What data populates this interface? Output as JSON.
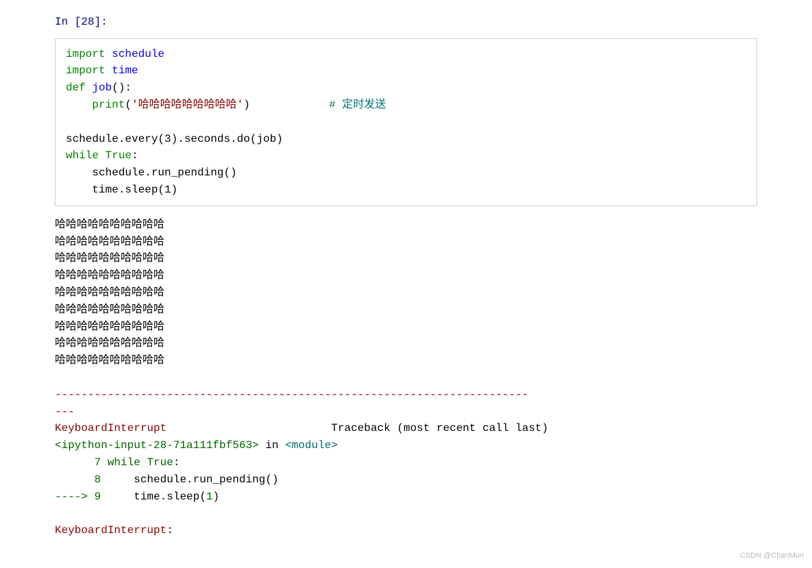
{
  "prompt": "In  [28]:",
  "code": {
    "l1": {
      "kw": "import",
      "mod": " schedule"
    },
    "l2": {
      "kw": "import",
      "mod": " time"
    },
    "l3": {
      "kw": "def",
      "name": " job",
      "paren": "():"
    },
    "l4": {
      "indent": "    ",
      "fn": "print",
      "open": "(",
      "str": "'哈哈哈哈哈哈哈哈哈'",
      "close": ")",
      "pad": "            ",
      "comment": "# 定时发送"
    },
    "l5": "",
    "l6": "schedule.every(3).seconds.do(job)",
    "l7": {
      "kw": "while",
      "cond": " True",
      "colon": ":"
    },
    "l8": "    schedule.run_pending()",
    "l9": "    time.sleep(1)"
  },
  "output_lines": [
    "哈哈哈哈哈哈哈哈哈哈",
    "哈哈哈哈哈哈哈哈哈哈",
    "哈哈哈哈哈哈哈哈哈哈",
    "哈哈哈哈哈哈哈哈哈哈",
    "哈哈哈哈哈哈哈哈哈哈",
    "哈哈哈哈哈哈哈哈哈哈",
    "哈哈哈哈哈哈哈哈哈哈",
    "哈哈哈哈哈哈哈哈哈哈",
    "哈哈哈哈哈哈哈哈哈哈"
  ],
  "traceback": {
    "sep": "------------------------------------------------------------------------\n---",
    "err_name": "KeyboardInterrupt",
    "tb_label": "                         Traceback (most recent call last)",
    "loc1": "<ipython-input-28-71a111fbf563>",
    "in": " in ",
    "loc2": "<module>",
    "line7": {
      "indent": "      ",
      "num": "7",
      "sp": " ",
      "kw": "while",
      "sp2": " ",
      "cond": "True",
      "colon": ":"
    },
    "line8": {
      "indent": "      ",
      "num": "8",
      "sp": "     schedule",
      "dot": ".",
      "fn": "run_pending",
      "paren": "()"
    },
    "line9": {
      "arrow": "----> ",
      "num": "9",
      "sp": "     time",
      "dot": ".",
      "fn": "sleep",
      "open": "(",
      "arg": "1",
      "close": ")"
    },
    "final": "KeyboardInterrupt",
    "final_colon": ": "
  },
  "watermark": "CSDN @ChanMon"
}
